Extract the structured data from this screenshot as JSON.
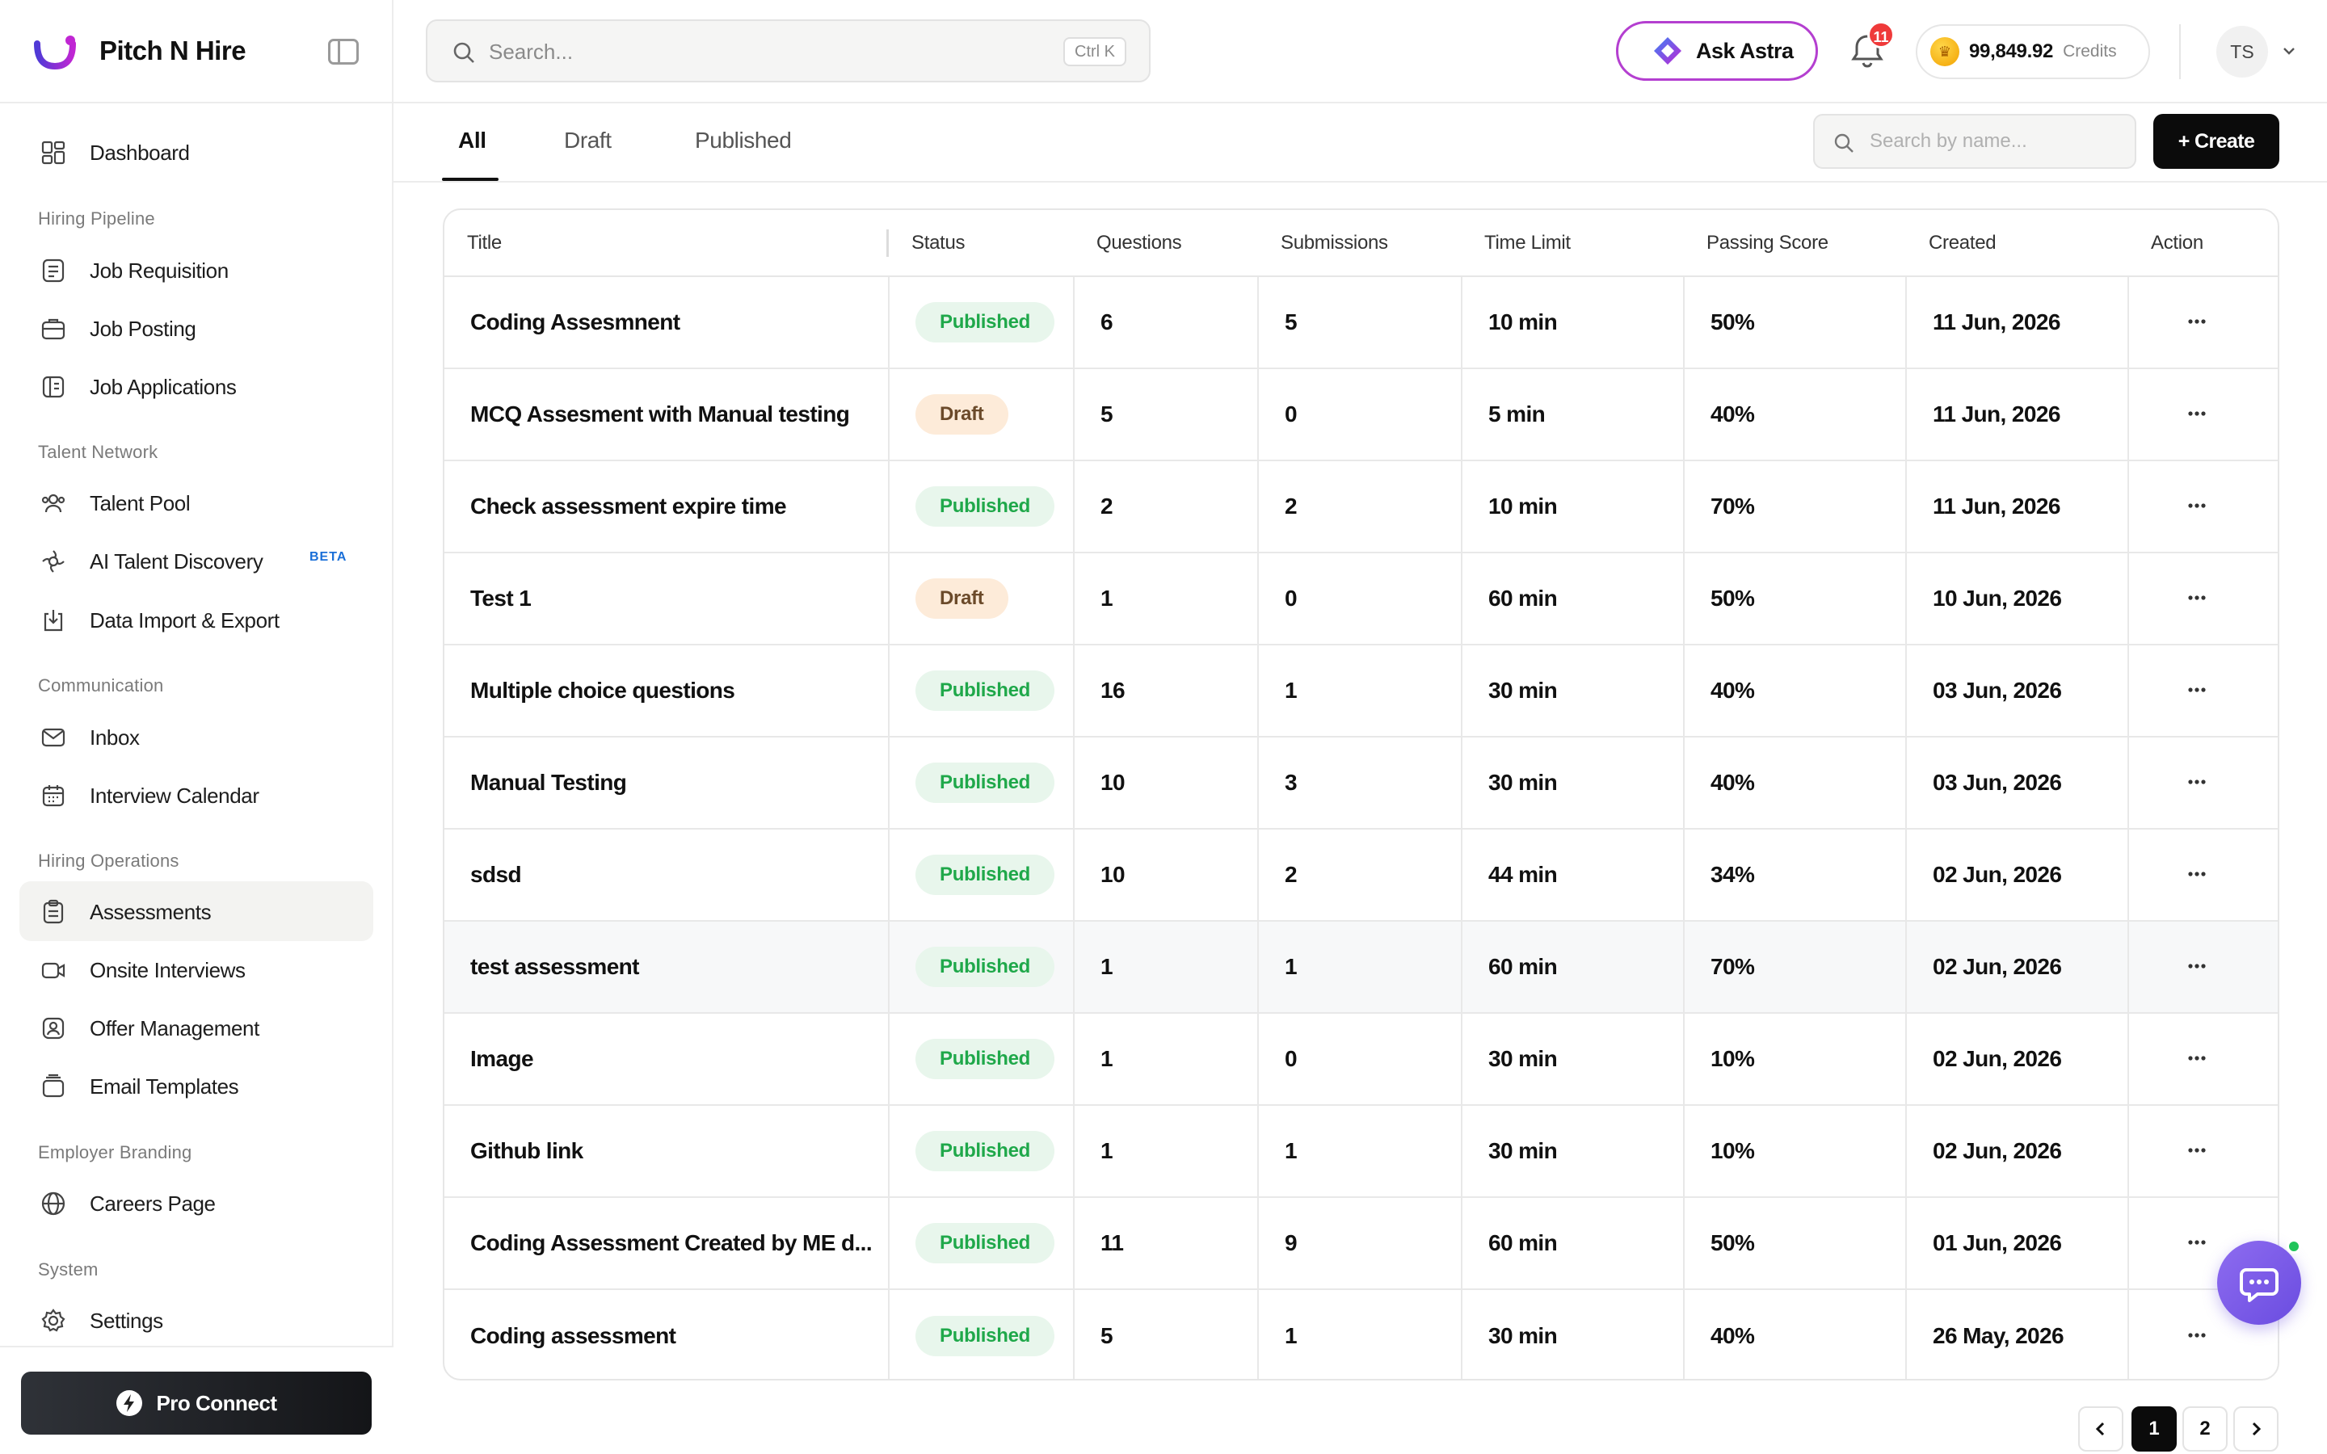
{
  "brand": {
    "name": "Pitch N Hire"
  },
  "sidebar": {
    "items": [
      {
        "label": "Dashboard"
      },
      {
        "label": "Job Requisition"
      },
      {
        "label": "Job Posting"
      },
      {
        "label": "Job Applications"
      },
      {
        "label": "Talent Pool"
      },
      {
        "label": "AI Talent Discovery",
        "badge": "BETA"
      },
      {
        "label": "Data Import & Export"
      },
      {
        "label": "Inbox"
      },
      {
        "label": "Interview Calendar"
      },
      {
        "label": "Assessments",
        "active": true
      },
      {
        "label": "Onsite Interviews"
      },
      {
        "label": "Offer Management"
      },
      {
        "label": "Email Templates"
      },
      {
        "label": "Careers Page"
      },
      {
        "label": "Settings"
      }
    ],
    "sections": [
      "Hiring Pipeline",
      "Talent Network",
      "Communication",
      "Hiring Operations",
      "Employer Branding",
      "System"
    ],
    "pro_connect": "Pro Connect"
  },
  "header": {
    "search_placeholder": "Search...",
    "search_shortcut": "Ctrl K",
    "ask_astra": "Ask Astra",
    "notification_count": "11",
    "credits_value": "99,849.92",
    "credits_label": "Credits",
    "avatar_initials": "TS"
  },
  "tabs": {
    "items": [
      "All",
      "Draft",
      "Published"
    ],
    "active": "All",
    "name_search_placeholder": "Search by name...",
    "create_label": "+ Create"
  },
  "table": {
    "columns": [
      "Title",
      "Status",
      "Questions",
      "Submissions",
      "Time Limit",
      "Passing Score",
      "Created",
      "Action"
    ],
    "rows": [
      {
        "title": "Coding Assesmnent",
        "status": "Published",
        "questions": "6",
        "submissions": "5",
        "time_limit": "10 min",
        "passing_score": "50%",
        "created": "11 Jun, 2026"
      },
      {
        "title": "MCQ Assesment with Manual testing",
        "status": "Draft",
        "questions": "5",
        "submissions": "0",
        "time_limit": "5 min",
        "passing_score": "40%",
        "created": "11 Jun, 2026"
      },
      {
        "title": "Check assessment expire time",
        "status": "Published",
        "questions": "2",
        "submissions": "2",
        "time_limit": "10 min",
        "passing_score": "70%",
        "created": "11 Jun, 2026"
      },
      {
        "title": "Test 1",
        "status": "Draft",
        "questions": "1",
        "submissions": "0",
        "time_limit": "60 min",
        "passing_score": "50%",
        "created": "10 Jun, 2026"
      },
      {
        "title": "Multiple choice questions",
        "status": "Published",
        "questions": "16",
        "submissions": "1",
        "time_limit": "30 min",
        "passing_score": "40%",
        "created": "03 Jun, 2026"
      },
      {
        "title": "Manual Testing",
        "status": "Published",
        "questions": "10",
        "submissions": "3",
        "time_limit": "30 min",
        "passing_score": "40%",
        "created": "03 Jun, 2026"
      },
      {
        "title": "sdsd",
        "status": "Published",
        "questions": "10",
        "submissions": "2",
        "time_limit": "44 min",
        "passing_score": "34%",
        "created": "02 Jun, 2026"
      },
      {
        "title": "test assessment",
        "status": "Published",
        "questions": "1",
        "submissions": "1",
        "time_limit": "60 min",
        "passing_score": "70%",
        "created": "02 Jun, 2026"
      },
      {
        "title": "Image",
        "status": "Published",
        "questions": "1",
        "submissions": "0",
        "time_limit": "30 min",
        "passing_score": "10%",
        "created": "02 Jun, 2026"
      },
      {
        "title": "Github link",
        "status": "Published",
        "questions": "1",
        "submissions": "1",
        "time_limit": "30 min",
        "passing_score": "10%",
        "created": "02 Jun, 2026"
      },
      {
        "title": "Coding Assessment Created by ME d...",
        "status": "Published",
        "questions": "11",
        "submissions": "9",
        "time_limit": "60 min",
        "passing_score": "50%",
        "created": "01 Jun, 2026"
      },
      {
        "title": "Coding assessment",
        "status": "Published",
        "questions": "5",
        "submissions": "1",
        "time_limit": "30 min",
        "passing_score": "40%",
        "created": "26 May, 2026"
      }
    ]
  },
  "pagination": {
    "pages": [
      "1",
      "2"
    ],
    "current": "1"
  },
  "colors": {
    "accent": "#0b0b0b",
    "published_text": "#1fa84a",
    "published_bg": "#e8f6ec",
    "draft_bg": "#fdebd9",
    "chat_fab": "#7b5ce8",
    "notification": "#ef3a3a"
  }
}
